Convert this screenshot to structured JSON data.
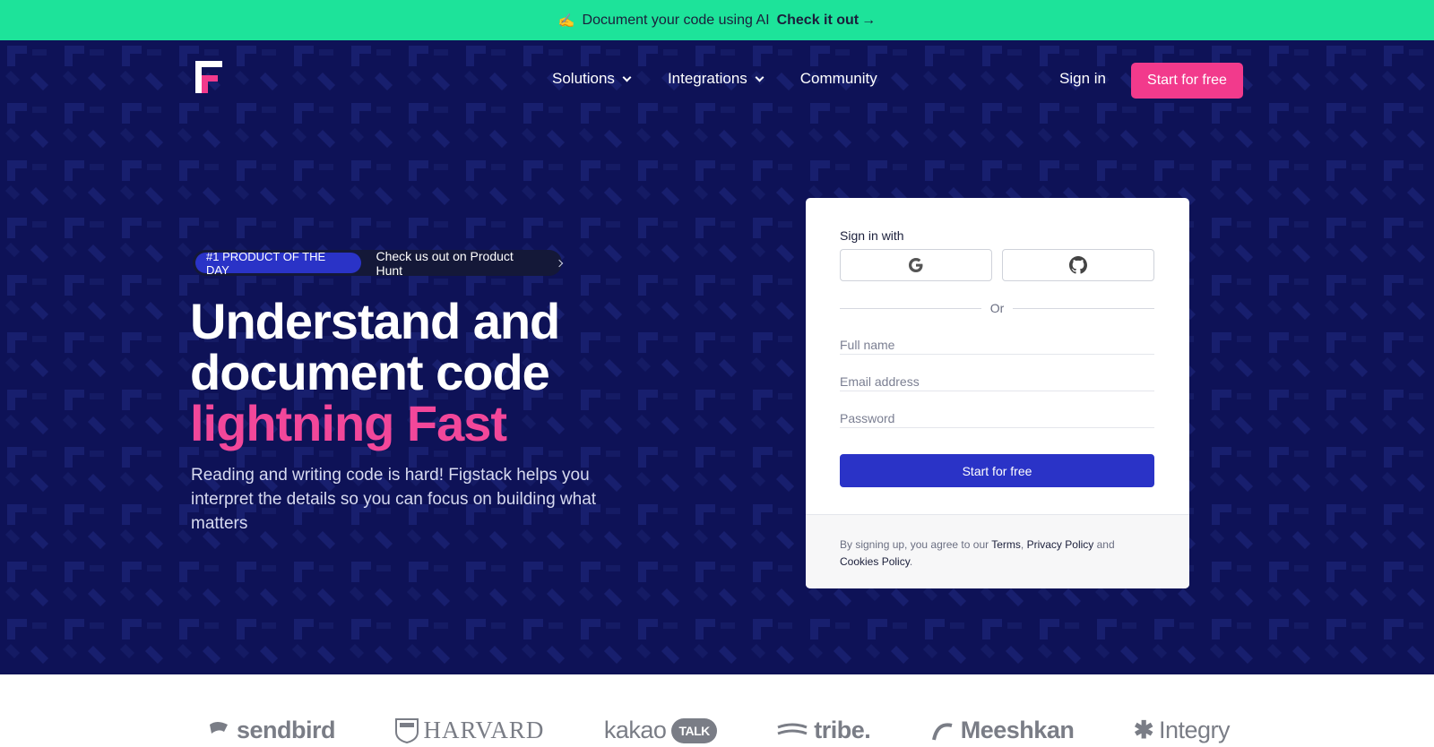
{
  "announcement": {
    "emoji": "✍️",
    "text": "Document your code using AI",
    "cta": "Check it out",
    "cta_arrow": "→"
  },
  "nav": {
    "items": [
      {
        "label": "Solutions",
        "has_dropdown": true
      },
      {
        "label": "Integrations",
        "has_dropdown": true
      },
      {
        "label": "Community",
        "has_dropdown": false
      }
    ],
    "signin": "Sign in",
    "cta": "Start for free"
  },
  "hero": {
    "badge": "#1 PRODUCT OF THE DAY",
    "badge_link": "Check us out on Product Hunt",
    "headline_line1": "Understand and",
    "headline_line2": "document code",
    "headline_accent": "lightning Fast",
    "subtext": "Reading and writing code is hard! Figstack helps you interpret the details so you can focus on building what matters"
  },
  "signup_card": {
    "sign_in_with": "Sign in with",
    "oauth": [
      {
        "provider": "google",
        "icon": "google-icon"
      },
      {
        "provider": "github",
        "icon": "github-icon"
      }
    ],
    "divider": "Or",
    "fields": {
      "full_name_placeholder": "Full name",
      "email_placeholder": "Email address",
      "password_placeholder": "Password"
    },
    "submit": "Start for free",
    "legal": {
      "prefix": "By signing up, you agree to our",
      "terms": "Terms",
      "comma": ",",
      "privacy": "Privacy Policy",
      "and": "and",
      "cookies": "Cookies Policy",
      "period": "."
    }
  },
  "customer_logos": [
    "sendbird",
    "HARVARD",
    "kakao",
    "TALK",
    "tribe.",
    "Meeshkan",
    "Integry"
  ],
  "colors": {
    "announcement_bg": "#1de39a",
    "hero_bg": "#0e1257",
    "accent_pink": "#f23a8c",
    "primary_blue": "#2a33c7"
  }
}
